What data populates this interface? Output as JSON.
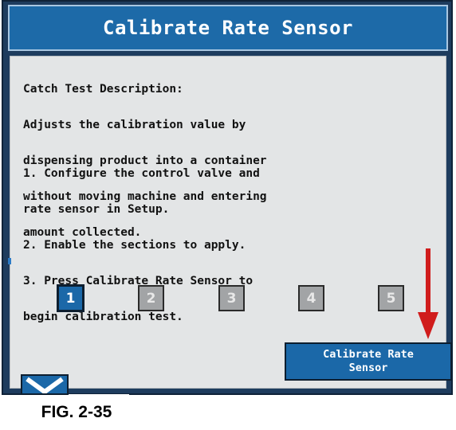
{
  "title": "Calibrate Rate Sensor",
  "description_lines": [
    "Catch Test Description:",
    "Adjusts the calibration value by",
    "dispensing product into a container",
    "without moving machine and entering",
    "amount collected."
  ],
  "steps_lines": [
    "1. Configure the control valve and",
    "rate sensor in Setup.",
    "2. Enable the sections to apply.",
    "3. Press Calibrate Rate Sensor to",
    "begin calibration test."
  ],
  "sections": [
    {
      "label": "1",
      "active": true
    },
    {
      "label": "2",
      "active": false
    },
    {
      "label": "3",
      "active": false
    },
    {
      "label": "4",
      "active": false
    },
    {
      "label": "5",
      "active": false
    }
  ],
  "calibrate_button": {
    "line1": "Calibrate Rate",
    "line2": "Sensor"
  },
  "figure_label": "FIG. 2-35",
  "icons": {
    "back": "chevron-down-icon",
    "pointer": "red-arrow-down-icon"
  },
  "colors": {
    "accent": "#1b68a8",
    "panel": "#e3e5e6",
    "arrow": "#d01c1c",
    "inactive": "#a2a4a6"
  }
}
